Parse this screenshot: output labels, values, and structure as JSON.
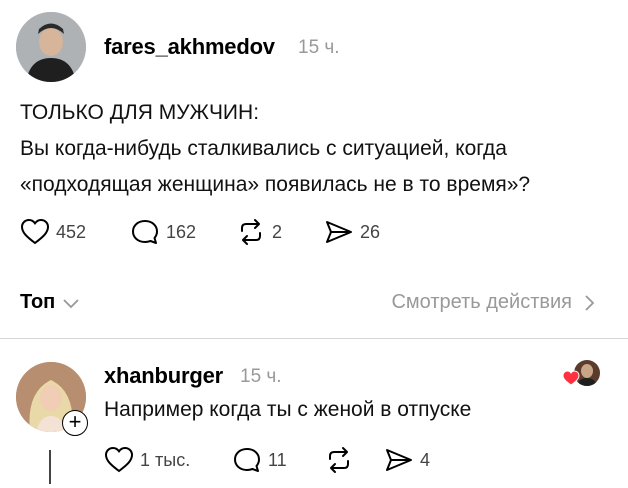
{
  "post": {
    "username": "fares_akhmedov",
    "time": "15 ч.",
    "title_line": "ТОЛЬКО ДЛЯ МУЖЧИН:",
    "body_line1": "Вы когда-нибудь сталкивались с ситуацией, когда",
    "body_line2": "«подходящая женщина» появилась не в то время»?",
    "likes": "452",
    "comments": "162",
    "reposts": "2",
    "shares": "26"
  },
  "filter": {
    "sort_label": "Топ",
    "view_activity_label": "Смотреть действия"
  },
  "reply": {
    "username": "xhanburger",
    "time": "15 ч.",
    "text": "Например когда ты с женой в отпуске",
    "likes": "1 тыс.",
    "comments": "11",
    "shares": "4"
  },
  "colors": {
    "like_heart": "#ff3040",
    "secondary_text": "#999999",
    "divider": "#d6d6d6"
  },
  "icons": [
    "heart-icon",
    "comment-icon",
    "repost-icon",
    "share-icon",
    "chevron-down-icon",
    "chevron-right-icon",
    "plus-icon"
  ]
}
